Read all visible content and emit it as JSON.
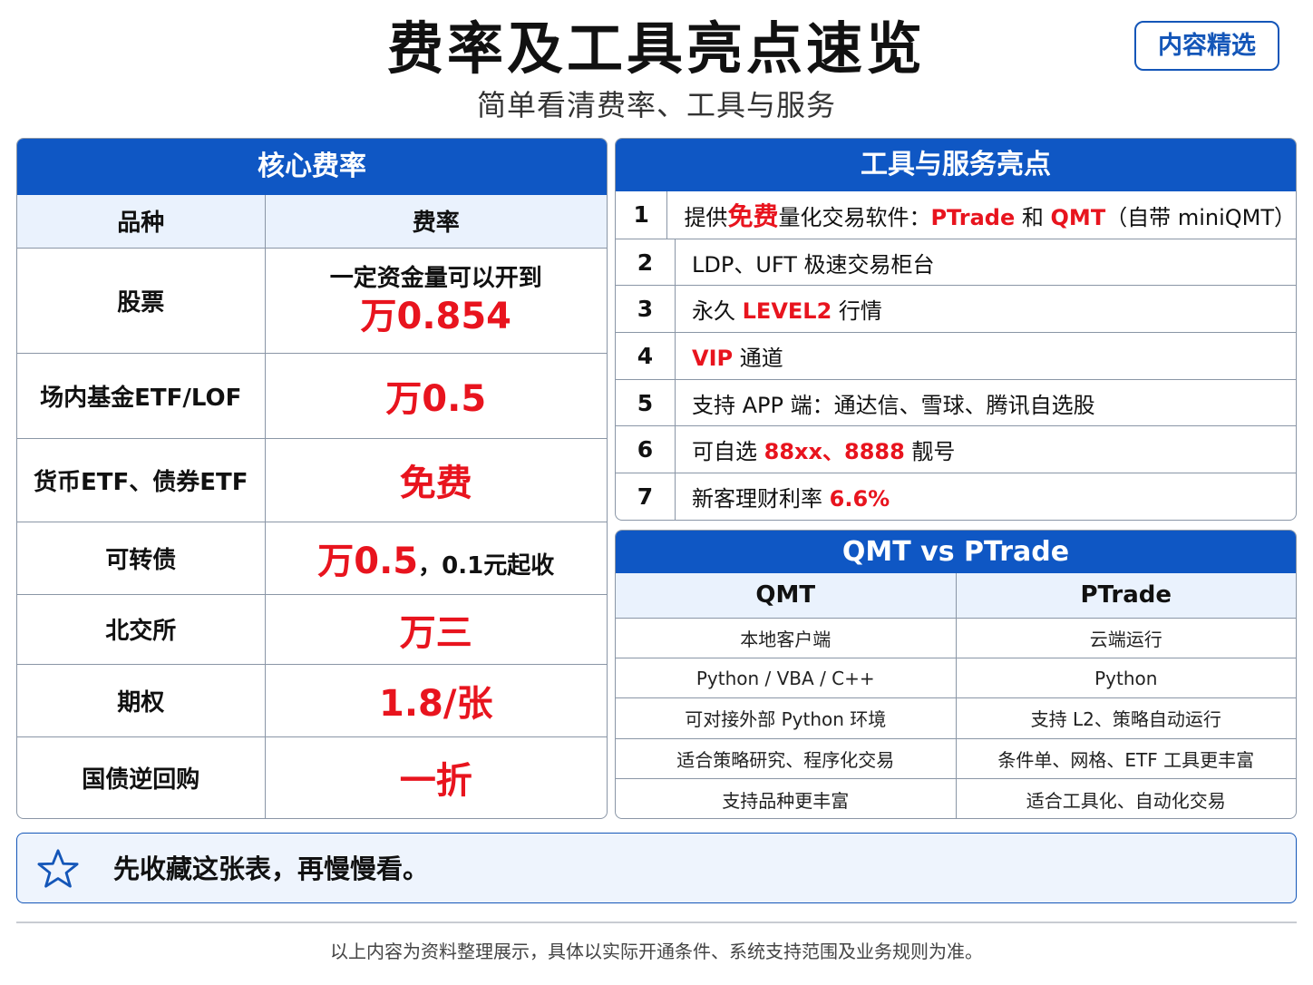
{
  "header": {
    "title": "费率及工具亮点速览",
    "subtitle": "简单看清费率、工具与服务",
    "badge": "内容精选"
  },
  "fees": {
    "title": "核心费率",
    "col_category": "品种",
    "col_rate": "费率",
    "rows": [
      {
        "category": "股票",
        "prefix": "一定资金量可以开到",
        "rate": "万0.854",
        "suffix": ""
      },
      {
        "category": "场内基金ETF/LOF",
        "prefix": "",
        "rate": "万0.5",
        "suffix": ""
      },
      {
        "category": "货币ETF、债券ETF",
        "prefix": "",
        "rate": "免费",
        "suffix": ""
      },
      {
        "category": "可转债",
        "prefix": "",
        "rate": "万0.5",
        "suffix": "，0.1元起收"
      },
      {
        "category": "北交所",
        "prefix": "",
        "rate": "万三",
        "suffix": ""
      },
      {
        "category": "期权",
        "prefix": "",
        "rate": "1.8/张",
        "suffix": ""
      },
      {
        "category": "国债逆回购",
        "prefix": "",
        "rate": "一折",
        "suffix": ""
      }
    ]
  },
  "tools": {
    "title": "工具与服务亮点",
    "items": [
      {
        "num": "1",
        "parts": [
          {
            "text": "提供",
            "hl": false
          },
          {
            "text": "免费",
            "hl": true,
            "big": true
          },
          {
            "text": "量化交易软件：",
            "hl": false
          },
          {
            "text": "PTrade",
            "hl": true
          },
          {
            "text": " 和 ",
            "hl": false
          },
          {
            "text": "QMT",
            "hl": true
          },
          {
            "text": "（自带 miniQMT）",
            "hl": false
          }
        ]
      },
      {
        "num": "2",
        "parts": [
          {
            "text": "LDP、UFT 极速交易柜台",
            "hl": false
          }
        ]
      },
      {
        "num": "3",
        "parts": [
          {
            "text": "永久 ",
            "hl": false
          },
          {
            "text": "LEVEL2",
            "hl": true
          },
          {
            "text": " 行情",
            "hl": false
          }
        ]
      },
      {
        "num": "4",
        "parts": [
          {
            "text": "VIP",
            "hl": true
          },
          {
            "text": " 通道",
            "hl": false
          }
        ]
      },
      {
        "num": "5",
        "parts": [
          {
            "text": "支持 APP 端：通达信、雪球、腾讯自选股",
            "hl": false
          }
        ]
      },
      {
        "num": "6",
        "parts": [
          {
            "text": "可自选 ",
            "hl": false
          },
          {
            "text": "88xx、8888",
            "hl": true
          },
          {
            "text": " 靓号",
            "hl": false
          }
        ]
      },
      {
        "num": "7",
        "parts": [
          {
            "text": "新客理财利率 ",
            "hl": false
          },
          {
            "text": "6.6%",
            "hl": true
          }
        ]
      }
    ]
  },
  "compare": {
    "title": "QMT vs PTrade",
    "col_left": "QMT",
    "col_right": "PTrade",
    "rows": [
      [
        "本地客户端",
        "云端运行"
      ],
      [
        "Python / VBA / C++",
        "Python"
      ],
      [
        "可对接外部 Python 环境",
        "支持 L2、策略自动运行"
      ],
      [
        "适合策略研究、程序化交易",
        "条件单、网格、ETF 工具更丰富"
      ],
      [
        "支持品种更丰富",
        "适合工具化、自动化交易"
      ]
    ]
  },
  "note": {
    "icon": "star-icon",
    "text": "先收藏这张表，再慢慢看。"
  },
  "footer": {
    "text": "以上内容为资料整理展示，具体以实际开通条件、系统支持范围及业务规则为准。"
  },
  "colors": {
    "primary": "#0f57c4",
    "highlight": "#e8141e",
    "header_row_bg": "#eaf2fd"
  }
}
